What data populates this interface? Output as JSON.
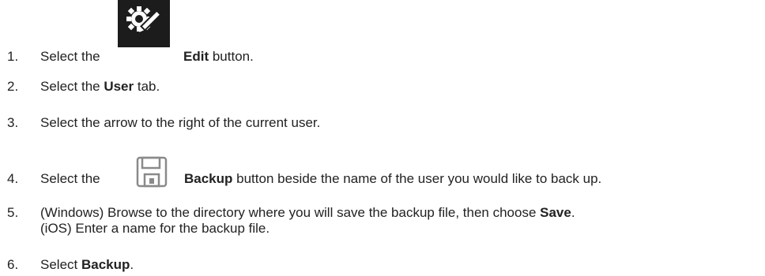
{
  "steps": [
    {
      "number": "1.",
      "before": "Select the",
      "icon": "edit-icon",
      "bold": "Edit",
      "after": " button."
    },
    {
      "number": "2.",
      "before": "Select the ",
      "bold": "User",
      "after": " tab."
    },
    {
      "number": "3.",
      "text": "Select the arrow to the right of the current user."
    },
    {
      "number": "4.",
      "before": "Select the",
      "icon": "save-icon",
      "bold": "Backup",
      "after": " button beside the name of the user you would like to back up."
    },
    {
      "number": "5.",
      "line1_before": "(Windows) Browse to the directory where you will save the backup file, then choose ",
      "line1_bold": "Save",
      "line1_after": ".",
      "line2": "(iOS) Enter a name for the backup file."
    },
    {
      "number": "6.",
      "before": "Select ",
      "bold": "Backup",
      "after": "."
    }
  ],
  "colors": {
    "text": "#222222",
    "icon_dark": "#1c1c1c",
    "icon_gray": "#8a8a8a"
  }
}
